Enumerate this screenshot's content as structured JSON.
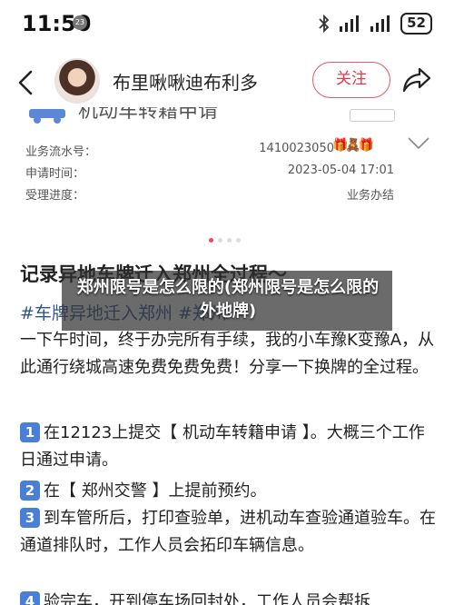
{
  "status_bar": {
    "time": "11:50",
    "notification_count": "23",
    "battery": "52"
  },
  "header": {
    "user_name": "布里啾啾迪布利多",
    "follow_label": "关注"
  },
  "image_card": {
    "title_clipped": "机动车转籍申请",
    "rows": [
      {
        "label": "业务流水号：",
        "value": "1410023050"
      },
      {
        "label": "申请时间：",
        "value": "2023-05-04 17:01"
      },
      {
        "label": "受理进度：",
        "value": "业务办结"
      }
    ],
    "sticker": "🎁🧸🎁"
  },
  "post": {
    "title": "记录异地车牌迁入郑州全过程～",
    "hashtag": "#车牌异地迁入郑州 #郑州",
    "paragraph1": "一下午时间，终于办完所有手续，我的小车豫K变豫A，从此通行绕城高速免费免费免费！分享一下换牌的全过程。",
    "steps": [
      {
        "num": "1",
        "text": "在12123上提交【 机动车转籍申请 】。大概三个工作日通过申请。"
      },
      {
        "num": "2",
        "text": "在【 郑州交警 】上提前预约。"
      },
      {
        "num": "3",
        "text": "到车管所后，打印查验单，进机动车查验通道验车。在通道排队时，工作人员会拓印车辆信息。"
      },
      {
        "num": "4",
        "text": "验完车，开到停车场回封处，工作人员会帮拆"
      }
    ]
  },
  "overlay": {
    "text": "郑州限号是怎么限的(郑州限号是怎么限的外地牌)"
  },
  "colors": {
    "accent_red": "#e4394f",
    "hashtag_blue": "#31548a",
    "badge_blue": "#4a7fd8"
  }
}
